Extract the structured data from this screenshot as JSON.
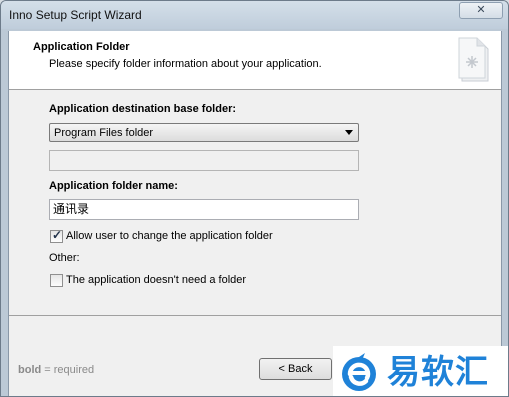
{
  "window": {
    "title": "Inno Setup Script Wizard",
    "close_icon": "close-icon"
  },
  "header": {
    "title": "Application Folder",
    "subtitle": "Please specify folder information about your application.",
    "icon": "document-icon"
  },
  "form": {
    "base_folder_label": "Application destination base folder:",
    "base_folder_value": "Program Files folder",
    "folder_name_label": "Application folder name:",
    "folder_name_value": "通讯录",
    "allow_change_label": "Allow user to change the application folder",
    "allow_change_checked": true,
    "other_label": "Other:",
    "no_folder_label": "The application doesn't need a folder",
    "no_folder_checked": false
  },
  "footer": {
    "legend_bold": "bold",
    "legend_rest": " = required",
    "back_label": "< Back"
  },
  "watermark": {
    "text": "易软汇",
    "logo_icon": "e-logo-icon",
    "brand_color": "#1f82d8"
  },
  "colors": {
    "header_bg": "#ffffff",
    "dialog_bg": "#f0f0f0",
    "frame": "#bcc9d6"
  }
}
